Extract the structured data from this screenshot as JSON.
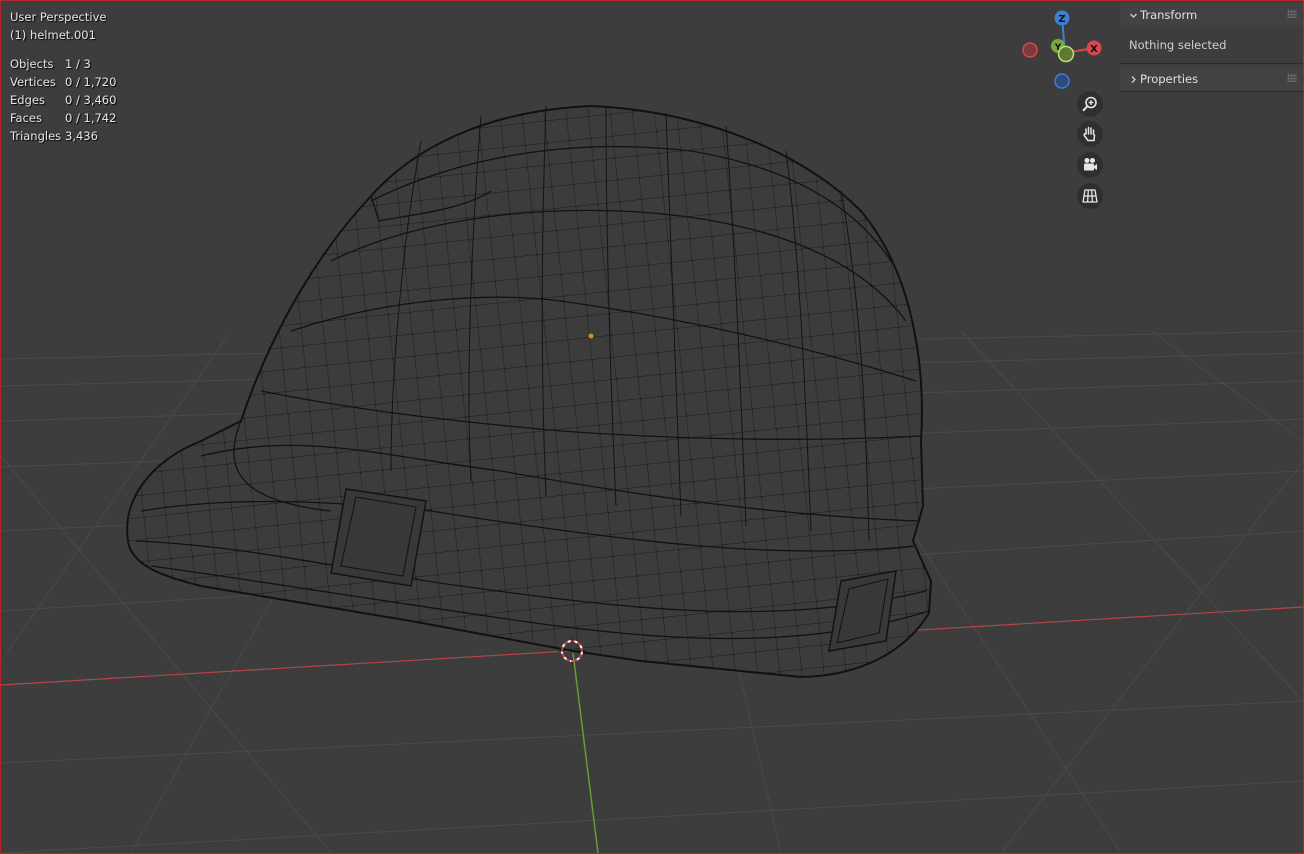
{
  "viewport": {
    "view_name": "User Perspective",
    "active_object": "(1) helmet.001"
  },
  "stats": [
    {
      "label": "Objects",
      "value": "1 / 3"
    },
    {
      "label": "Vertices",
      "value": "0 / 1,720"
    },
    {
      "label": "Edges",
      "value": "0 / 3,460"
    },
    {
      "label": "Faces",
      "value": "0 / 1,742"
    },
    {
      "label": "Triangles",
      "value": "3,436"
    }
  ],
  "gizmo": {
    "z_label": "Z",
    "y_label": "Y",
    "x_label": "X",
    "colors": {
      "x": "#d8474f",
      "y": "#79a93d",
      "z": "#3f7fd3"
    }
  },
  "nav_buttons": [
    {
      "name": "zoom-icon"
    },
    {
      "name": "hand-icon"
    },
    {
      "name": "camera-icon"
    },
    {
      "name": "grid-icon"
    }
  ],
  "sidebar": {
    "transform_title": "Transform",
    "transform_message": "Nothing selected",
    "properties_title": "Properties"
  },
  "colors": {
    "background": "#3d3d3d",
    "border": "#b3262c",
    "wire": "#111111",
    "x_axis": "#b4454b",
    "y_axis": "#6b9a35",
    "origin": "#e08a1a"
  }
}
